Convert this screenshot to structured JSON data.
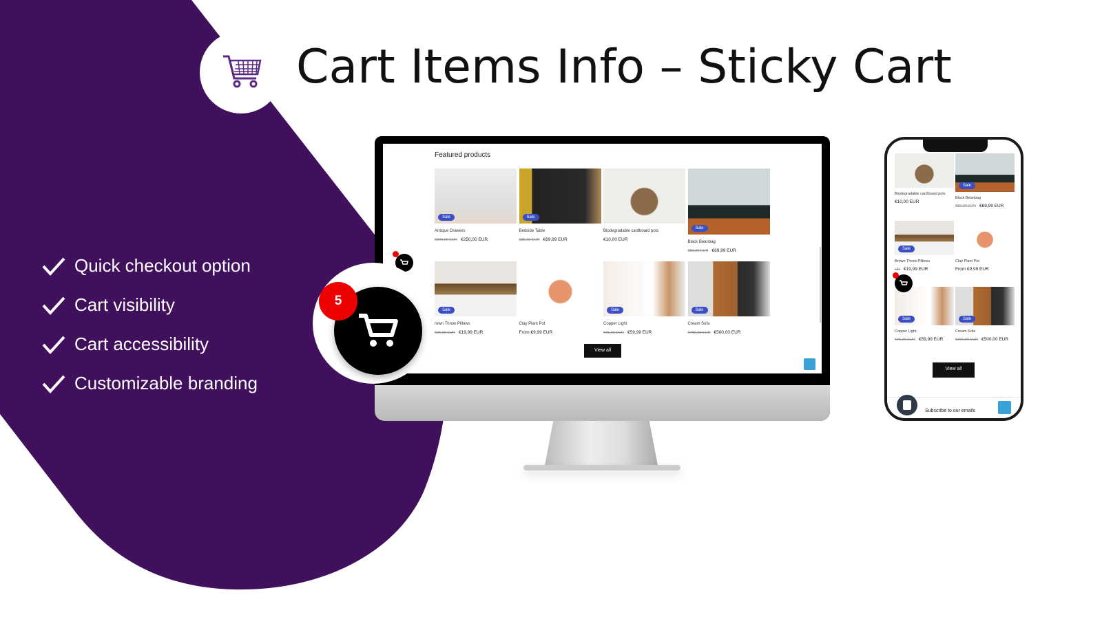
{
  "header": {
    "title": "Cart Items Info – Sticky Cart",
    "logo_icon": "shopping-cart-icon"
  },
  "colors": {
    "brand_purple": "#40105c",
    "badge_red": "#e00000",
    "sale_blue": "#3a4fc1"
  },
  "features": [
    "Quick checkout option",
    "Cart visibility",
    "Cart accessibility",
    "Customizable branding"
  ],
  "sticky_cart": {
    "count": "5"
  },
  "desktop": {
    "section_title": "Featured products",
    "view_all": "View all",
    "products": [
      {
        "name": "Antique Drawers",
        "old": "€300,00 EUR",
        "price": "€250,00 EUR",
        "sale": "Sale"
      },
      {
        "name": "Bedside Table",
        "old": "€85,00 EUR",
        "price": "€69,99 EUR",
        "sale": "Sale"
      },
      {
        "name": "Biodegradable cardboard pots",
        "old": "",
        "price": "€10,00 EUR",
        "sale": ""
      },
      {
        "name": "Black Beanbag",
        "old": "€80,00 EUR",
        "price": "€69,99 EUR",
        "sale": "Sale"
      },
      {
        "name": "rown Throw Pillows",
        "old": "€25,00 EUR",
        "price": "€19,99 EUR",
        "sale": "Sale"
      },
      {
        "name": "Clay Plant Pot",
        "old": "",
        "price": "From €9,99 EUR",
        "sale": ""
      },
      {
        "name": "Copper Light",
        "old": "€75,00 EUR",
        "price": "€59,99 EUR",
        "sale": "Sale"
      },
      {
        "name": "Cream Sofa",
        "old": "€750,00 EUR",
        "price": "€500,00 EUR",
        "sale": "Sale"
      }
    ]
  },
  "mobile": {
    "view_all": "View all",
    "subscribe": "Subscribe to our emails",
    "products": [
      {
        "name": "Biodegradable cardboard pots",
        "old": "",
        "price": "€10,00 EUR",
        "sale": ""
      },
      {
        "name": "Black Beanbag",
        "old": "€80,00 EUR",
        "price": "€69,99 EUR",
        "sale": "Sale"
      },
      {
        "name": "Brown Throw Pillows",
        "old": "UR",
        "price": "€19,99 EUR",
        "sale": "Sale"
      },
      {
        "name": "Clay Plant Pot",
        "old": "",
        "price": "From €9,99 EUR",
        "sale": ""
      },
      {
        "name": "Copper Light",
        "old": "€75,00 EUR",
        "price": "€59,99 EUR",
        "sale": "Sale"
      },
      {
        "name": "Cream Sofa",
        "old": "€750,00 EUR",
        "price": "€500,00 EUR",
        "sale": "Sale"
      }
    ]
  }
}
